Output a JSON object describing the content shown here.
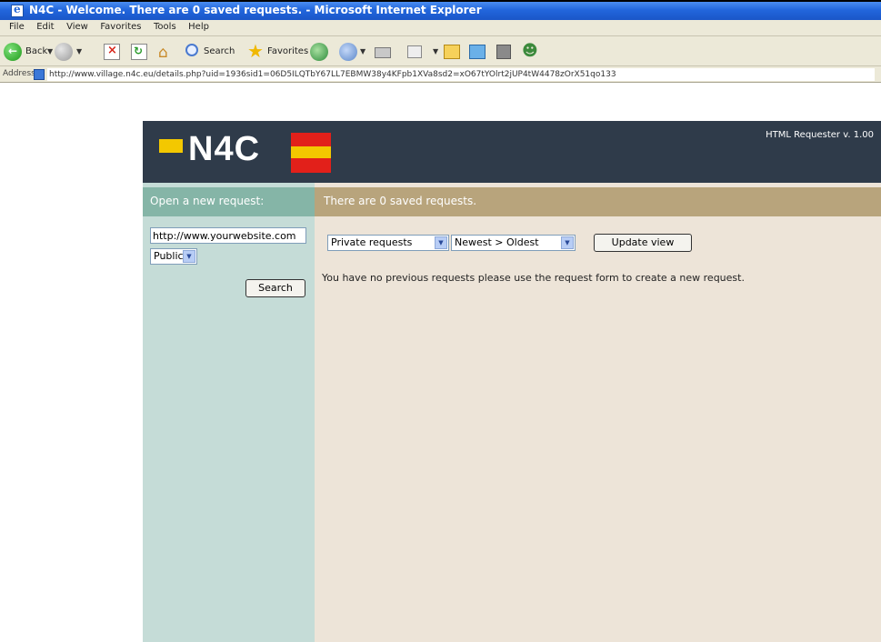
{
  "window": {
    "title": "N4C - Welcome. There are 0 saved requests. - Microsoft Internet Explorer"
  },
  "menu": [
    "File",
    "Edit",
    "View",
    "Favorites",
    "Tools",
    "Help"
  ],
  "toolbar": {
    "back_label": "Back",
    "search_label": "Search",
    "favorites_label": "Favorites"
  },
  "address": {
    "label": "Address",
    "url": "http://www.village.n4c.eu/details.php?uid=1936sid1=06D5ILQTbY67LL7EBMW38y4KFpb1XVa8sd2=xO67tYOlrt2jUP4tW4478zOrX51qo133"
  },
  "header": {
    "logo_text": "N4C",
    "version": "HTML Requester v. 1.00"
  },
  "sidebar": {
    "title": "Open a new request:",
    "url_placeholder": "http://www.yourwebsite.com",
    "visibility": "Public",
    "search_button": "Search"
  },
  "main": {
    "title": "There are 0 saved requests.",
    "type_filter": "Private requests",
    "order_filter": "Newest > Oldest",
    "update_button": "Update view",
    "empty_message": "You have no previous requests please use the request form to create a new request."
  },
  "colors": {
    "header_bg": "#2f3b4a",
    "sidebar_bg": "#c5dcd7",
    "sidebar_head": "#85b5a7",
    "main_bg": "#ede4d8",
    "main_head": "#b8a47c",
    "logo_yellow": "#f3c800",
    "logo_red": "#e2201a"
  }
}
